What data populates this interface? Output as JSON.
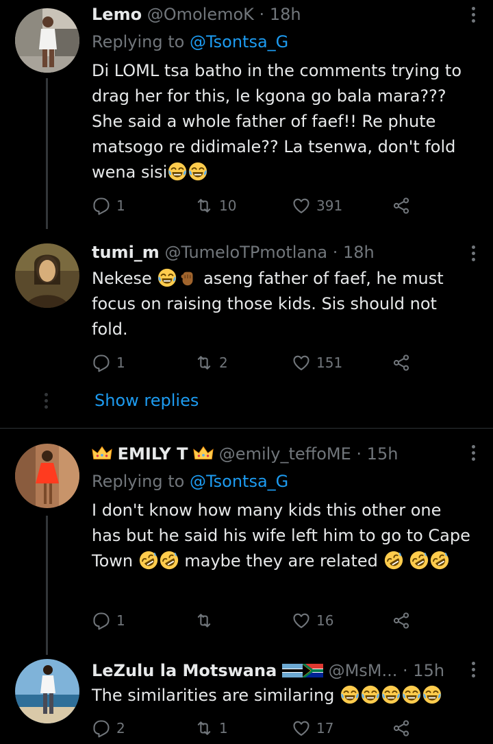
{
  "colors": {
    "background": "#000000",
    "text": "#e7e9ea",
    "muted": "#71767b",
    "accent": "#1d9bf0"
  },
  "tweets": [
    {
      "name": "Lemo",
      "handle": "@OmolemoK",
      "sep": "·",
      "time": "18h",
      "replying_prefix": "Replying to",
      "replying_handle": "@Tsontsa_G",
      "text": "Di LOML tsa batho in the comments trying to drag her for this, le kgona go bala mara??? She said a whole father of faef!! Re phute matsogo re didimale?? La tsenwa, don't fold wena sisi",
      "replies": "1",
      "retweets": "10",
      "likes": "391"
    },
    {
      "name": "tumi_m",
      "handle": "@TumeloTPmotlana",
      "sep": "·",
      "time": "18h",
      "text_a": "Nekese",
      "text_b": "aseng father of faef, he must focus on raising those kids. Sis should not fold.",
      "replies": "1",
      "retweets": "2",
      "likes": "151"
    },
    {
      "name": "EMILY T",
      "handle": "@emily_teffoME",
      "sep": "·",
      "time": "15h",
      "replying_prefix": "Replying to",
      "replying_handle": "@Tsontsa_G",
      "text_a": "I don't know how many kids this other one has but he said his wife left him to go to Cape Town",
      "text_b": "maybe they are related",
      "replies": "1",
      "retweets": "",
      "likes": "16"
    },
    {
      "name": "LeZulu la Motswana",
      "handle": "@MsM...",
      "sep": "·",
      "time": "15h",
      "text": "The similarities are similaring",
      "replies": "2",
      "retweets": "1",
      "likes": "17"
    }
  ],
  "show_replies": "Show replies"
}
